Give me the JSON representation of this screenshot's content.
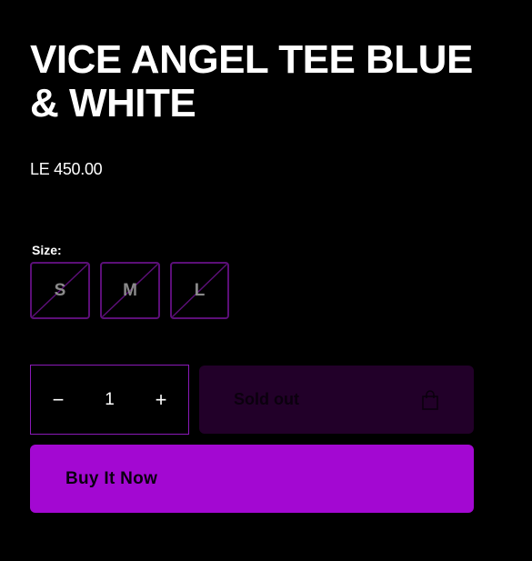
{
  "product": {
    "title": "VICE ANGEL TEE BLUE & WHITE",
    "price": "LE 450.00"
  },
  "size_selector": {
    "label": "Size:",
    "options": [
      {
        "label": "S",
        "available": false
      },
      {
        "label": "M",
        "available": false
      },
      {
        "label": "L",
        "available": false
      }
    ]
  },
  "quantity": {
    "decrease_label": "−",
    "value": "1",
    "increase_label": "+"
  },
  "sold_out_button": {
    "label": "Sold out",
    "icon": "shopping-bag-icon"
  },
  "buy_now_button": {
    "label": "Buy It Now"
  },
  "colors": {
    "background": "#000000",
    "accent": "#a308d2",
    "sold_out_bg": "#220029",
    "size_border": "#5c0f78"
  }
}
